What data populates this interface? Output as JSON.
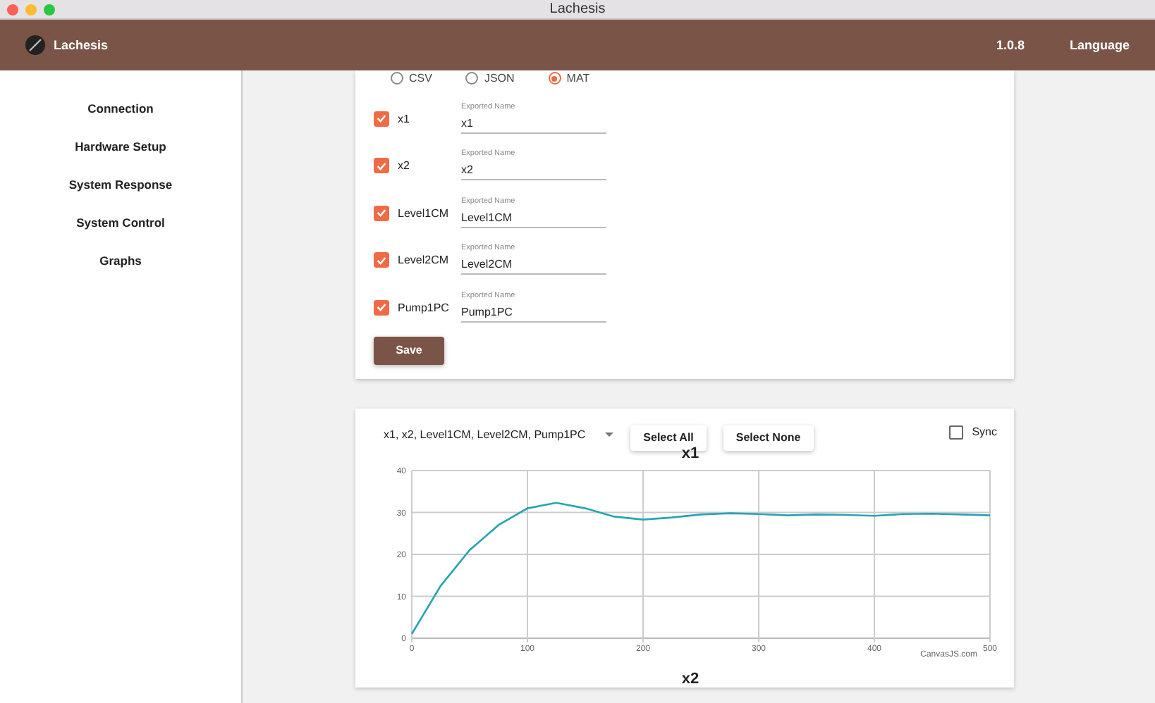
{
  "window": {
    "title": "Lachesis"
  },
  "header": {
    "app_name": "Lachesis",
    "version": "1.0.8",
    "language": "Language"
  },
  "sidebar": {
    "items": [
      {
        "label": "Connection"
      },
      {
        "label": "Hardware Setup"
      },
      {
        "label": "System Response"
      },
      {
        "label": "System Control"
      },
      {
        "label": "Graphs"
      }
    ]
  },
  "export": {
    "formats": [
      {
        "label": "CSV",
        "selected": false
      },
      {
        "label": "JSON",
        "selected": false
      },
      {
        "label": "MAT",
        "selected": true
      }
    ],
    "fields": [
      {
        "label": "x1",
        "checked": true,
        "field_label": "Exported Name",
        "value": "x1"
      },
      {
        "label": "x2",
        "checked": true,
        "field_label": "Exported Name",
        "value": "x2"
      },
      {
        "label": "Level1CM",
        "checked": true,
        "field_label": "Exported Name",
        "value": "Level1CM"
      },
      {
        "label": "Level2CM",
        "checked": true,
        "field_label": "Exported Name",
        "value": "Level2CM"
      },
      {
        "label": "Pump1PC",
        "checked": true,
        "field_label": "Exported Name",
        "value": "Pump1PC"
      }
    ],
    "save_button": "Save"
  },
  "graphs": {
    "series_select": "x1, x2, Level1CM, Level2CM, Pump1PC",
    "select_all": "Select All",
    "select_none": "Select None",
    "sync": {
      "label": "Sync",
      "checked": false
    },
    "charts": [
      {
        "title": "x1",
        "credit": "CanvasJS.com",
        "chart_data": {
          "type": "line",
          "x": [
            0,
            25,
            50,
            75,
            100,
            125,
            150,
            175,
            200,
            225,
            250,
            275,
            300,
            325,
            350,
            375,
            400,
            425,
            450,
            475,
            500
          ],
          "grid": true,
          "series": [
            {
              "color": "#2aa3b3",
              "values": [
                1,
                12.5,
                21,
                27,
                31,
                32.3,
                31,
                29,
                28.3,
                28.8,
                29.5,
                29.8,
                29.6,
                29.3,
                29.5,
                29.4,
                29.2,
                29.6,
                29.7,
                29.5,
                29.3
              ]
            }
          ],
          "xlim": [
            0,
            500
          ],
          "ylim": [
            0,
            40
          ],
          "xticks": [
            0,
            100,
            200,
            300,
            400,
            500
          ],
          "yticks": [
            0,
            10,
            20,
            30,
            40
          ]
        }
      },
      {
        "title": "x2"
      }
    ]
  }
}
